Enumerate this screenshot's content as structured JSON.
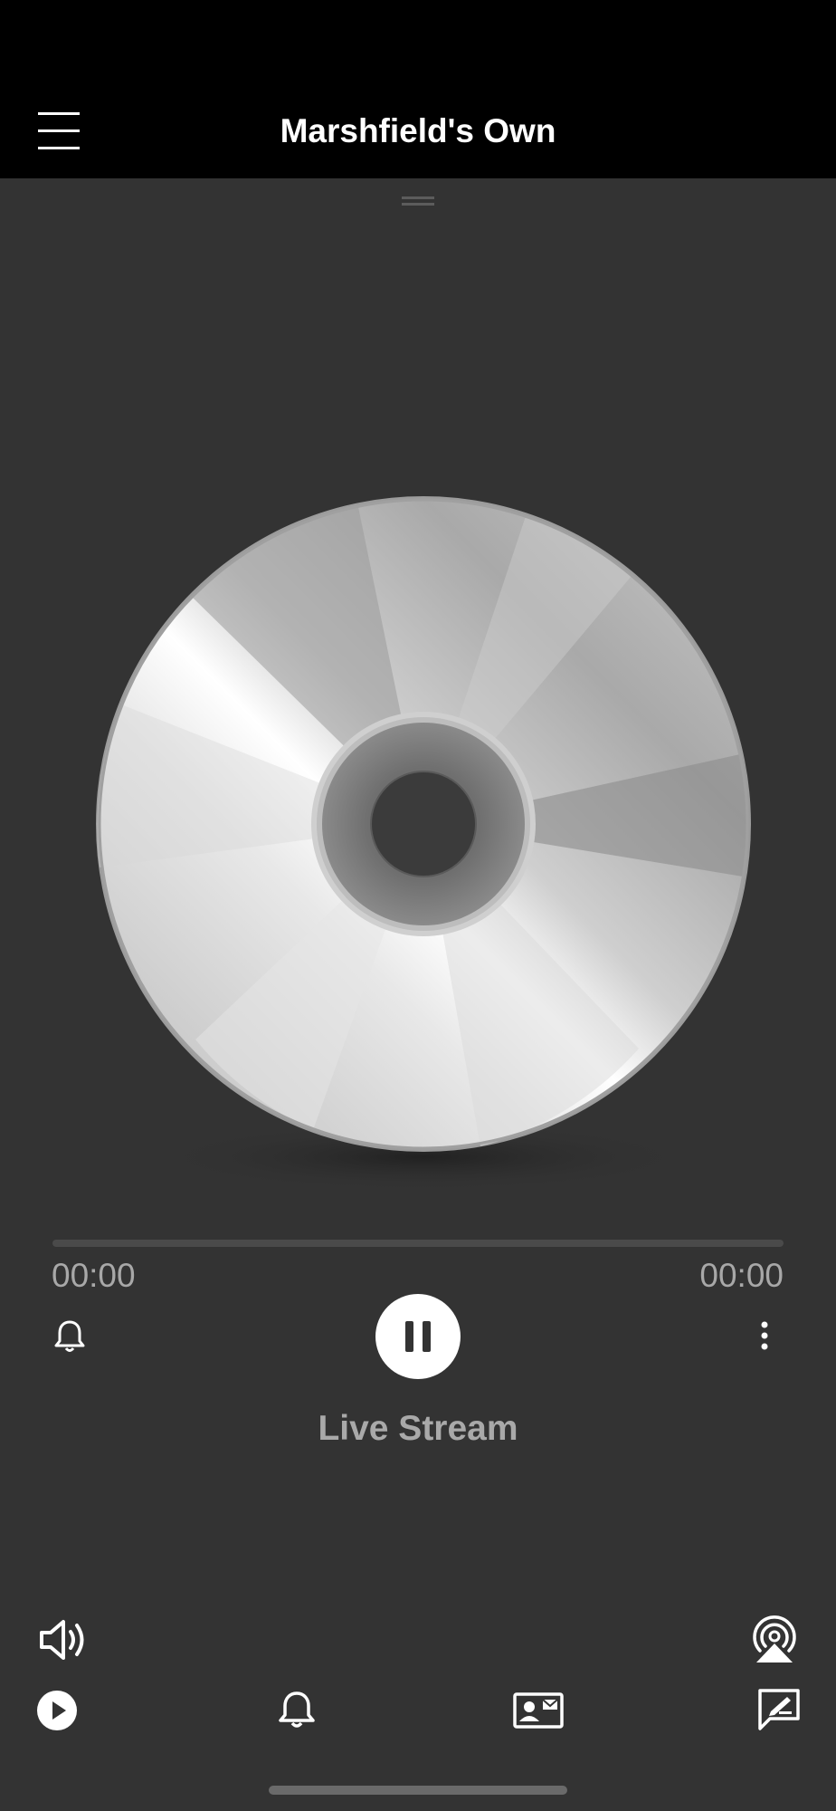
{
  "header": {
    "title": "Marshfield's Own",
    "menu_icon": "hamburger-menu-icon"
  },
  "player": {
    "artwork_icon": "compact-disc-icon",
    "progress": 0,
    "elapsed": "00:00",
    "duration": "00:00",
    "track_title": "Live Stream",
    "state": "playing",
    "controls": {
      "alarm_icon": "bell-icon",
      "play_pause_icon": "pause-icon",
      "more_icon": "more-vertical-icon"
    }
  },
  "bottom_bar": {
    "volume_icon": "speaker-icon",
    "airplay_icon": "airplay-audio-icon",
    "tabs": [
      {
        "icon": "play-circle-icon"
      },
      {
        "icon": "bell-icon"
      },
      {
        "icon": "contact-card-icon"
      },
      {
        "icon": "compose-message-icon"
      }
    ]
  },
  "colors": {
    "background": "#333333",
    "header": "#000000",
    "text_primary": "#ffffff",
    "text_secondary": "#a8a8a8"
  }
}
